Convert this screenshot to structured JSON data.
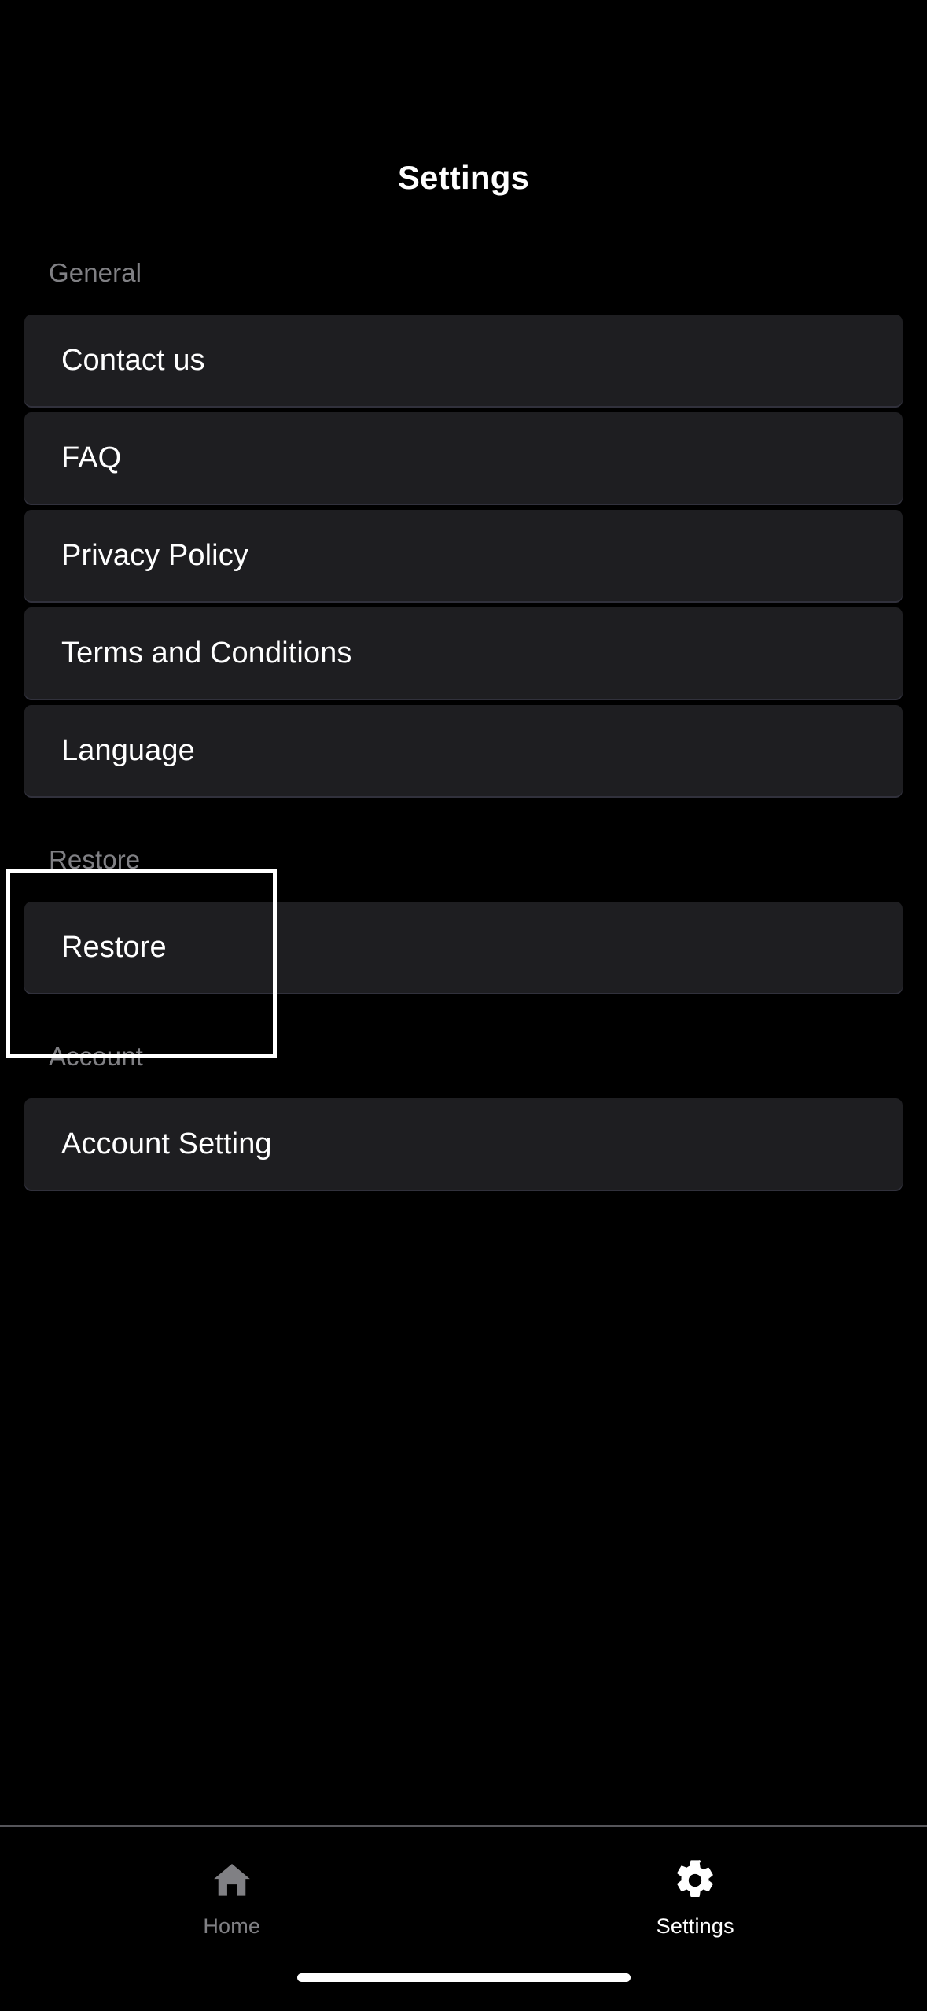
{
  "header": {
    "title": "Settings"
  },
  "sections": [
    {
      "id": "general",
      "header": "General",
      "items": [
        {
          "label": "Contact us"
        },
        {
          "label": "FAQ"
        },
        {
          "label": "Privacy Policy"
        },
        {
          "label": "Terms and Conditions"
        },
        {
          "label": "Language"
        }
      ]
    },
    {
      "id": "restore",
      "header": "Restore",
      "items": [
        {
          "label": "Restore"
        }
      ]
    },
    {
      "id": "account",
      "header": "Account",
      "items": [
        {
          "label": "Account Setting"
        }
      ]
    }
  ],
  "annotation": {
    "target": "Restore"
  },
  "tabbar": {
    "items": [
      {
        "label": "Home",
        "icon": "home-icon",
        "active": false
      },
      {
        "label": "Settings",
        "icon": "gear-icon",
        "active": true
      }
    ]
  },
  "colors": {
    "background": "#000000",
    "card": "#1e1e21",
    "card_separator": "#3a3a46",
    "primary_text": "#ffffff",
    "secondary_text": "#808084",
    "divider": "#55555a",
    "annotation_border": "#ffffff",
    "home_indicator": "#ffffff"
  }
}
